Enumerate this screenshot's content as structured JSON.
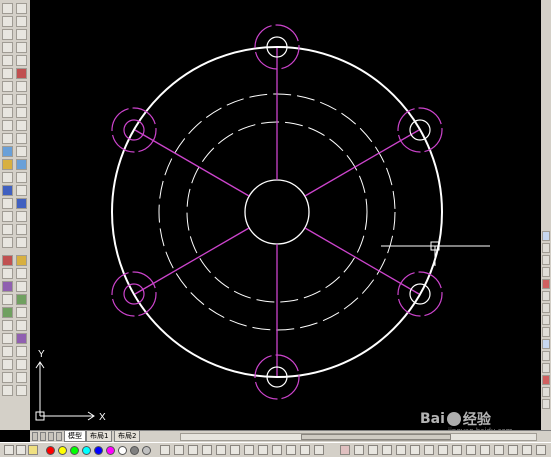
{
  "app": {
    "name": "AutoCAD drawing window"
  },
  "drawing": {
    "background": "#000000",
    "outline_color": "#ffffff",
    "hole_color": "#cc44cc",
    "rib_color": "#cc44cc",
    "ucs_axis_x": "X",
    "ucs_axis_y": "Y"
  },
  "layout_tabs": {
    "tabs": [
      "模型",
      "布局1",
      "布局2"
    ],
    "active": "模型"
  },
  "color_bar": {
    "colors": [
      "#ff0000",
      "#ffff00",
      "#00ff00",
      "#00ffff",
      "#0000ff",
      "#ff00ff",
      "#ffffff",
      "#808080",
      "#c0c0c0"
    ]
  },
  "watermark": {
    "brand": "Bai",
    "brand_suffix": "经验",
    "url": "jingyan.baidu.com"
  }
}
